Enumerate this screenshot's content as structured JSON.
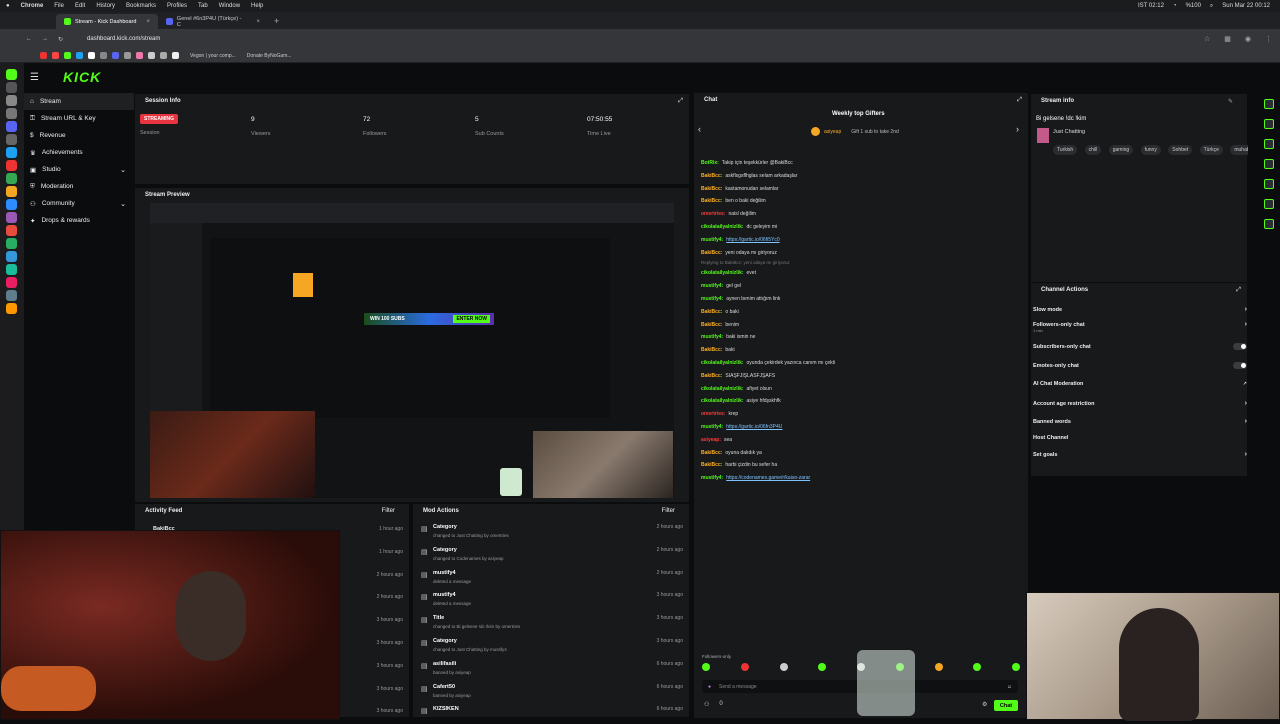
{
  "menubar": {
    "app": "Chrome",
    "items": [
      "File",
      "Edit",
      "History",
      "Bookmarks",
      "Profiles",
      "Tab",
      "Window",
      "Help"
    ],
    "clock": "Sun Mar 22  00:12",
    "ist_time": "IST 02:12",
    "battery": "%100"
  },
  "browser": {
    "tabs": [
      {
        "label": "Stream - Kick Dashboard",
        "active": true
      },
      {
        "label": "Genel #6n3P4U (Türkçe) - C",
        "active": false
      }
    ],
    "url": "dashboard.kick.com/stream",
    "bookmarks": [
      "Vegon | your comp...",
      "Donate ByNoGam..."
    ]
  },
  "header": {
    "logo": "KICK"
  },
  "sidebar": {
    "items": [
      {
        "label": "Stream",
        "active": true
      },
      {
        "label": "Stream URL & Key"
      },
      {
        "label": "Revenue"
      },
      {
        "label": "Achievements"
      },
      {
        "label": "Studio",
        "chevron": true
      },
      {
        "label": "Moderation"
      },
      {
        "label": "Community",
        "chevron": true
      },
      {
        "label": "Drops & rewards"
      }
    ]
  },
  "session": {
    "title": "Session Info",
    "status": "STREAMING",
    "status_label": "Session",
    "viewers": "9",
    "viewers_label": "Viewers",
    "followers": "72",
    "followers_label": "Followers",
    "subs": "5",
    "subs_label": "Sub Counts",
    "time": "07:50:55",
    "time_label": "Time Live"
  },
  "preview": {
    "title": "Stream Preview",
    "banner": "WIN 100 SUBS",
    "enter": "ENTER NOW"
  },
  "activity": {
    "title": "Activity Feed",
    "filter": "Filter",
    "first_user": "BakiBcc",
    "times": [
      "1 hour ago",
      "1 hour ago",
      "2 hours ago",
      "2 hours ago",
      "3 hours ago",
      "3 hours ago",
      "3 hours ago",
      "3 hours ago",
      "3 hours ago"
    ]
  },
  "modactions": {
    "title": "Mod Actions",
    "filter": "Filter",
    "rows": [
      {
        "title": "Category",
        "sub": "changed to Just Chatting by omertries",
        "time": "2 hours ago"
      },
      {
        "title": "Category",
        "sub": "changed to Codenames by asiyeap",
        "time": "2 hours ago"
      },
      {
        "title": "mustify4",
        "sub": "deleted a message",
        "time": "2 hours ago"
      },
      {
        "title": "mustify4",
        "sub": "deleted a message",
        "time": "3 hours ago"
      },
      {
        "title": "Title",
        "sub": "changed to Bi gelsene !dc !kim by omertries",
        "time": "3 hours ago"
      },
      {
        "title": "Category",
        "sub": "changed to Just Chatting by mustify4",
        "time": "3 hours ago"
      },
      {
        "title": "asilifasili",
        "sub": "banned by asiyeap",
        "time": "6 hours ago"
      },
      {
        "title": "Cafert50",
        "sub": "banned by asiyeap",
        "time": "6 hours ago"
      },
      {
        "title": "KIZSIKEN",
        "sub": "",
        "time": "6 hours ago"
      }
    ]
  },
  "chat": {
    "title": "Chat",
    "gifters_title": "Weekly top Gifters",
    "top_gifter": "asiyeap",
    "gift_note": "Gift 1 sub to take 2nd",
    "messages": [
      {
        "u": "BotRix:",
        "c": "#53fc18",
        "t": "Takip için teşekkürler @BakiBcc"
      },
      {
        "u": "BakiBcc:",
        "c": "#ffb01f",
        "t": "askflsgsflhglas selam arkadaşlar"
      },
      {
        "u": "BakiBcc:",
        "c": "#ffb01f",
        "t": "kastamonudan selamlar"
      },
      {
        "u": "BakiBcc:",
        "c": "#ffb01f",
        "t": "ben o baki değilim"
      },
      {
        "u": "omertries:",
        "c": "#ff3a3a",
        "t": "naisl değilim"
      },
      {
        "u": "cikolatailyalnizlik:",
        "c": "#53fc18",
        "t": "dc geleyim mi"
      },
      {
        "u": "mustify4:",
        "c": "#53fc18",
        "t": "https://gartic.io/06fi5Yc0",
        "link": true
      },
      {
        "u": "BakiBcc:",
        "c": "#ffb01f",
        "t": "yeni odaya mı giriyoruz"
      },
      {
        "u": "cikolatailyalnizlik:",
        "c": "#53fc18",
        "t": "evet",
        "reply": "Replying to BakiBcc: yeni odaya mı giriyoruz"
      },
      {
        "u": "mustify4:",
        "c": "#53fc18",
        "t": "gel gel"
      },
      {
        "u": "mustify4:",
        "c": "#53fc18",
        "t": "aynen benim attığım link"
      },
      {
        "u": "BakiBcc:",
        "c": "#ffb01f",
        "t": "o baki"
      },
      {
        "u": "BakiBcc:",
        "c": "#ffb01f",
        "t": "benim"
      },
      {
        "u": "mustify4:",
        "c": "#53fc18",
        "t": "baki ismin ne"
      },
      {
        "u": "BakiBcc:",
        "c": "#ffb01f",
        "t": "baki"
      },
      {
        "u": "cikolatailyalnizlik:",
        "c": "#53fc18",
        "t": "oyunda çekirdek yazınca canım mı çekti"
      },
      {
        "u": "BakiBcc:",
        "c": "#ffb01f",
        "t": "SIAŞFJIŞLASFJŞAFS"
      },
      {
        "u": "cikolatailyalnizlik:",
        "c": "#53fc18",
        "t": "afiyet olsun"
      },
      {
        "u": "cikolatailyalnizlik:",
        "c": "#53fc18",
        "t": "asiye hfdşskhfk"
      },
      {
        "u": "omertries:",
        "c": "#ff3a3a",
        "t": "krep"
      },
      {
        "u": "mustify4:",
        "c": "#53fc18",
        "t": "https://gartic.io/06fn3P4U",
        "link": true
      },
      {
        "u": "asiyeap:",
        "c": "#ff3a3a",
        "t": "sea"
      },
      {
        "u": "BakiBcc:",
        "c": "#ffb01f",
        "t": "oyuna dalıdık ya"
      },
      {
        "u": "BakiBcc:",
        "c": "#ffb01f",
        "t": "harbi çizdin bu sefer ha"
      },
      {
        "u": "mustify4:",
        "c": "#53fc18",
        "t": "https://codenames.game/r/kaiso-zarar",
        "link": true
      }
    ],
    "followers_only": "Followers-only",
    "placeholder": "Send a message",
    "send": "Chat",
    "count": "0"
  },
  "streaminfo": {
    "title": "Stream info",
    "stream_title": "Bi gelsene !dc !kim",
    "category": "Just Chatting",
    "tags": [
      "Turkish",
      "chill",
      "gaming",
      "funny",
      "Sohbet",
      "Türkçe",
      "muhab"
    ]
  },
  "channelactions": {
    "title": "Channel Actions",
    "rows": [
      {
        "label": "Slow mode",
        "kind": "chev"
      },
      {
        "label": "Followers-only chat",
        "sub": "1 min",
        "kind": "chev"
      },
      {
        "label": "Subscribers-only chat",
        "kind": "toggle"
      },
      {
        "label": "Emotes-only chat",
        "kind": "toggle"
      },
      {
        "label": "AI Chat Moderation",
        "kind": "ext"
      },
      {
        "label": "Account age restriction",
        "kind": "chev"
      },
      {
        "label": "Banned words",
        "kind": "chev"
      },
      {
        "label": "Host Channel",
        "kind": "none"
      },
      {
        "label": "Set goals",
        "kind": "chev"
      }
    ]
  },
  "colors": {
    "accent": "#53fc18",
    "streaming": "#e8343f",
    "panel": "#18191b",
    "bg": "#0b0c0d"
  }
}
